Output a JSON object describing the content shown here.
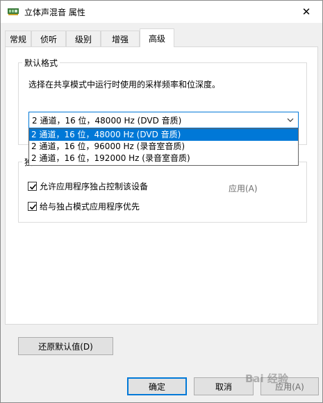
{
  "window": {
    "title": "立体声混音 属性",
    "close_glyph": "✕"
  },
  "tabs": [
    {
      "label": "常规",
      "active": false
    },
    {
      "label": "侦听",
      "active": false
    },
    {
      "label": "级别",
      "active": false
    },
    {
      "label": "增强",
      "active": false
    },
    {
      "label": "高级",
      "active": true
    }
  ],
  "default_format": {
    "group_label": "默认格式",
    "description": "选择在共享模式中运行时使用的采样频率和位深度。",
    "selected": "2 通道，16 位，48000 Hz (DVD 音质)",
    "options": [
      "2 通道，16 位，48000 Hz (DVD 音质)",
      "2 通道，16 位，96000 Hz (录音室音质)",
      "2 通道，16 位，192000 Hz (录音室音质)"
    ]
  },
  "exclusive_mode": {
    "group_label_partial": "独",
    "allow_exclusive": {
      "label": "允许应用程序独占控制该设备",
      "checked": true
    },
    "give_priority": {
      "label": "给与独占模式应用程序优先",
      "checked": true
    }
  },
  "buttons": {
    "restore_defaults": "还原默认值(D)",
    "ok": "确定",
    "cancel": "取消",
    "apply_partial": "应用(A)"
  },
  "watermark": "Bai 经验",
  "colors": {
    "accent": "#0078d7",
    "panel": "#ffffff",
    "window": "#f0f0f0"
  }
}
